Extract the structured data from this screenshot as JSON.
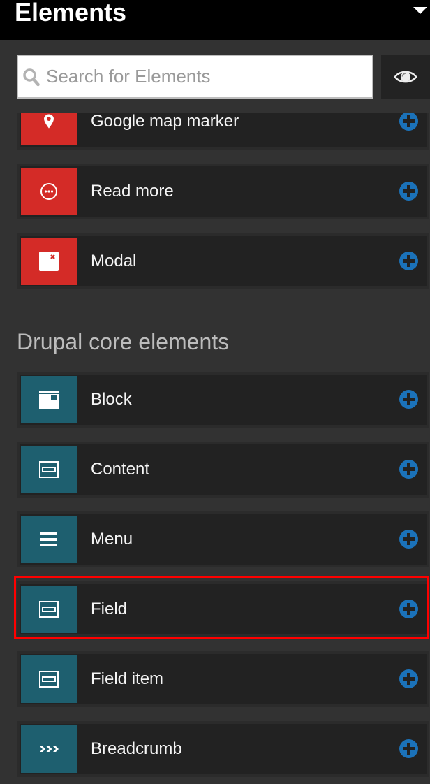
{
  "header": {
    "title": "Elements",
    "collapse_icon": "caret-down-icon"
  },
  "search": {
    "placeholder": "Search for Elements",
    "value": "",
    "search_icon": "search-icon",
    "visibility_toggle_icon": "eye-icon"
  },
  "custom_elements": {
    "items": [
      {
        "label": "Google map marker",
        "icon": "map-marker-icon",
        "add_icon": "plus-circle-icon"
      },
      {
        "label": "Read more",
        "icon": "ellipsis-circle-icon",
        "add_icon": "plus-circle-icon"
      },
      {
        "label": "Modal",
        "icon": "modal-window-icon",
        "add_icon": "plus-circle-icon"
      }
    ]
  },
  "drupal_core": {
    "heading": "Drupal core elements",
    "items": [
      {
        "label": "Block",
        "icon": "block-icon",
        "add_icon": "plus-circle-icon"
      },
      {
        "label": "Content",
        "icon": "field-box-icon",
        "add_icon": "plus-circle-icon"
      },
      {
        "label": "Menu",
        "icon": "hamburger-menu-icon",
        "add_icon": "plus-circle-icon"
      },
      {
        "label": "Field",
        "icon": "field-box-icon",
        "add_icon": "plus-circle-icon"
      },
      {
        "label": "Field item",
        "icon": "field-box-icon",
        "add_icon": "plus-circle-icon"
      },
      {
        "label": "Breadcrumb",
        "icon": "breadcrumb-chevrons-icon",
        "add_icon": "plus-circle-icon"
      }
    ]
  },
  "highlight": {
    "target_label": "Field",
    "color": "#ff0000"
  },
  "colors": {
    "custom_element_accent": "#d42b27",
    "core_element_accent": "#1e5f6f",
    "add_button": "#1b72b9"
  }
}
